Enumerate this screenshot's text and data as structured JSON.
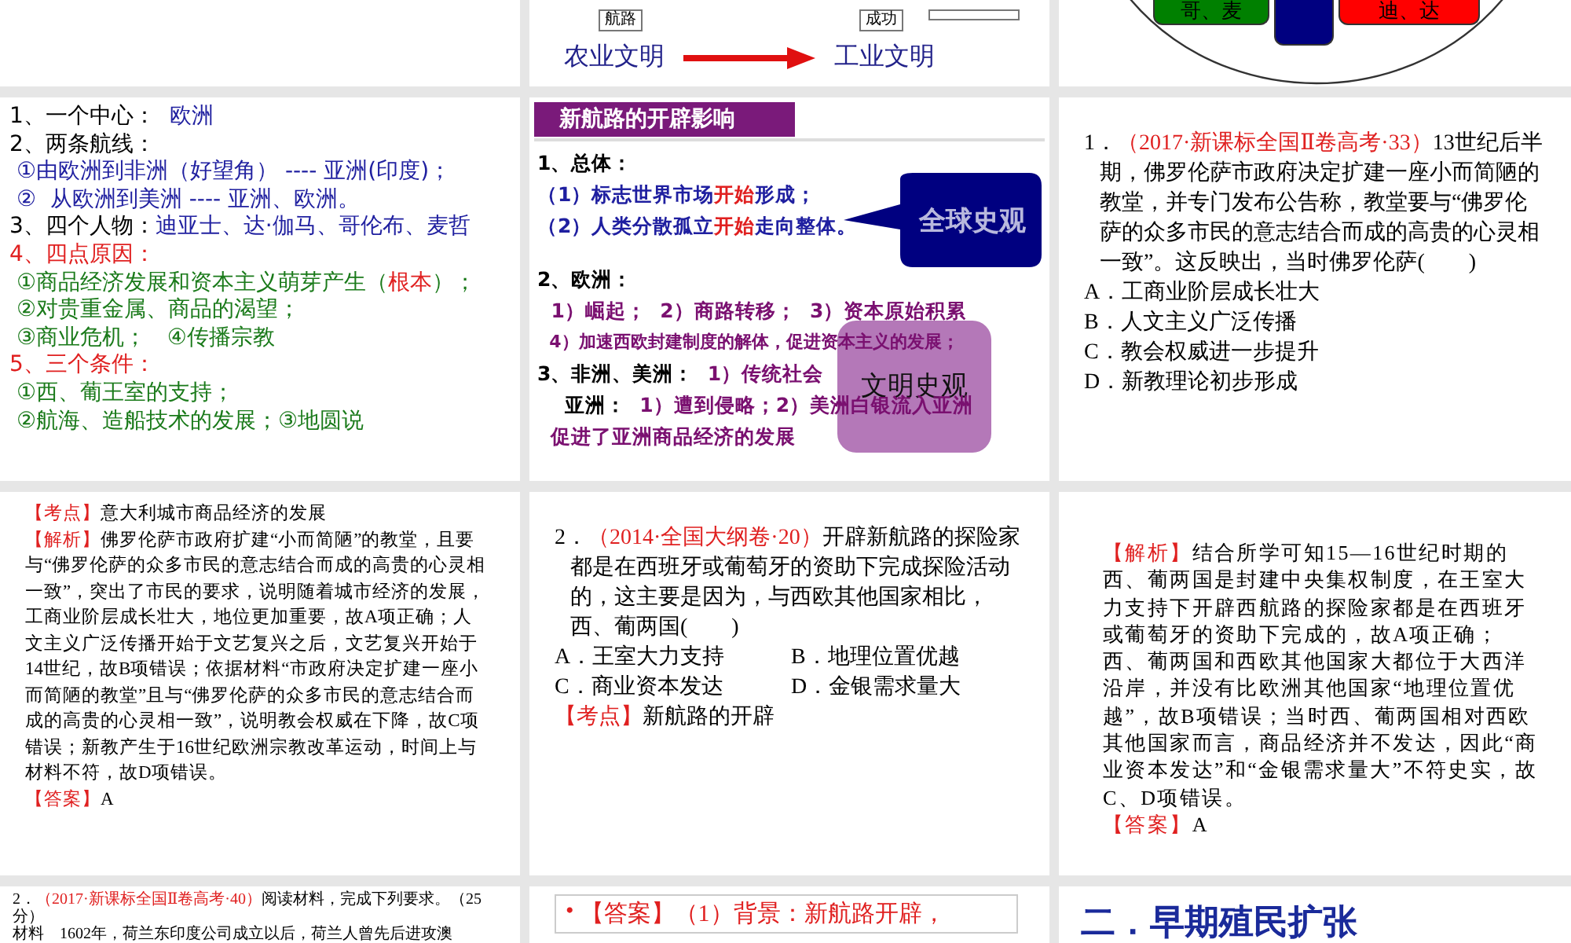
{
  "slides": [
    {
      "kind": "blank"
    },
    {
      "kind": "flow",
      "boxes": [
        "航路",
        "成功"
      ],
      "from": "农业文明",
      "to": "工业文明"
    },
    {
      "kind": "circle",
      "boxes": [
        {
          "text": "哥、麦",
          "color": "#008000"
        },
        {
          "color": "#000080"
        },
        {
          "text": "迪、达",
          "color": "#ff0000"
        }
      ]
    },
    {
      "kind": "outline",
      "lines": [
        {
          "segments": [
            {
              "text": "1、一个中心：  ",
              "color": "#000000"
            },
            {
              "text": "欧洲",
              "color": "#2020a0"
            }
          ]
        },
        {
          "segments": [
            {
              "text": "2、两条航线：",
              "color": "#000000"
            }
          ]
        },
        {
          "segments": [
            {
              "text": " ①由欧洲到非洲（好望角） ---- 亚洲(印度)；",
              "color": "#2020a0"
            }
          ]
        },
        {
          "segments": [
            {
              "text": " ②  从欧洲到美洲 ---- 亚洲、欧洲。",
              "color": "#2020a0"
            }
          ]
        },
        {
          "segments": [
            {
              "text": "3、四个人物：",
              "color": "#000000"
            },
            {
              "text": "迪亚士、达·伽马、哥伦布、麦哲",
              "color": "#2020a0"
            }
          ]
        },
        {
          "segments": [
            {
              "text": "4、四点原因：",
              "color": "#e02020"
            }
          ]
        },
        {
          "segments": [
            {
              "text": " ①商品经济发展和资本主义萌芽产生（",
              "color": "#1a7a1a"
            },
            {
              "text": "根本",
              "color": "#e02020"
            },
            {
              "text": "）；",
              "color": "#1a7a1a"
            }
          ]
        },
        {
          "segments": [
            {
              "text": " ②对贵重金属、商品的渴望；",
              "color": "#1a7a1a"
            }
          ]
        },
        {
          "segments": [
            {
              "text": " ③商业危机；   ④传播宗教",
              "color": "#1a7a1a"
            }
          ]
        },
        {
          "segments": [
            {
              "text": "5、三个条件：",
              "color": "#e02020"
            }
          ]
        },
        {
          "segments": [
            {
              "text": " ①西、葡王室的支持；",
              "color": "#1a7a1a"
            }
          ]
        },
        {
          "segments": [
            {
              "text": " ②航海、造船技术的发展；③地圆说",
              "color": "#1a7a1a"
            }
          ]
        }
      ]
    },
    {
      "kind": "impact",
      "title": "新航路的开辟影响",
      "lines": [
        {
          "segments": [
            {
              "text": "1、总体：",
              "color": "#000000"
            }
          ]
        },
        {
          "segments": [
            {
              "text": "（1）标志世界市场",
              "color": "#1f1fa0"
            },
            {
              "text": "开始",
              "color": "#e02020"
            },
            {
              "text": "形成；",
              "color": "#1f1fa0"
            }
          ]
        },
        {
          "segments": [
            {
              "text": "（2）人类分散孤立",
              "color": "#1f1fa0"
            },
            {
              "text": "开始",
              "color": "#e02020"
            },
            {
              "text": "走向整体。",
              "color": "#1f1fa0"
            }
          ]
        },
        {
          "segments": [
            {
              "text": "2、欧洲：",
              "color": "#000000"
            }
          ]
        },
        {
          "segments": [
            {
              "text": "  1）崛起；  2）商路转移；  3）资本原始积累",
              "color": "#7a1070"
            }
          ]
        },
        {
          "segments": [
            {
              "text": "  4）加速西欧封建制度的解体，促进资本主义的发展；",
              "color": "#7a1070"
            }
          ]
        },
        {
          "segments": [
            {
              "text": "3、非洲、美洲：  ",
              "color": "#000000"
            },
            {
              "text": "1）传统社会",
              "color": "#7a1070"
            }
          ]
        },
        {
          "segments": [
            {
              "text": "    亚洲：  ",
              "color": "#000000"
            },
            {
              "text": "1）遭到侵略；2）美洲白银流入亚洲",
              "color": "#7a1070"
            }
          ]
        },
        {
          "segments": [
            {
              "text": "  促进了亚洲商品经济的发展",
              "color": "#7a1070"
            }
          ]
        }
      ],
      "bubbles": [
        {
          "text": "全球史观",
          "color": "#000080"
        },
        {
          "text": "文明史观",
          "color": "#b478b8"
        }
      ]
    },
    {
      "kind": "question",
      "paragraphs": [
        {
          "segments": [
            {
              "text": "1．",
              "color": "#000000"
            },
            {
              "text": "（2017·新课标全国Ⅱ卷高考·33）",
              "color": "#e02020"
            },
            {
              "text": "13世纪后半期，佛罗伦萨市政府决定扩建一座小而简陋的教堂，并专门发布公告称，教堂要与“佛罗伦萨的众多市民的意志结合而成的高贵的心灵相一致”。这反映出，当时佛罗伦萨(　　)",
              "color": "#000000"
            }
          ]
        }
      ],
      "options": [
        [
          "A．工商业阶层成长壮大"
        ],
        [
          "B．人文主义广泛传播"
        ],
        [
          "C．教会权威进一步提升"
        ],
        [
          "D．新教理论初步形成"
        ]
      ]
    },
    {
      "kind": "analysis",
      "paragraphs": [
        {
          "segments": [
            {
              "text": "【考点】",
              "color": "#e02020"
            },
            {
              "text": "意大利城市商品经济的发展",
              "color": "#000000"
            }
          ]
        },
        {
          "segments": [
            {
              "text": "【解析】",
              "color": "#e02020"
            },
            {
              "text": "佛罗伦萨市政府扩建“小而简陋”的教堂，且要与“佛罗伦萨的众多市民的意志结合而成的高贵的心灵相一致”，突出了市民的要求，说明随着城市经济的发展，工商业阶层成长壮大，地位更加重要，故A项正确；人文主义广泛传播开始于文艺复兴之后，文艺复兴开始于14世纪，故B项错误；依据材料“市政府决定扩建一座小而简陋的教堂”且与“佛罗伦萨的众多市民的意志结合而成的高贵的心灵相一致”，说明教会权威在下降，故C项错误；新教产生于16世纪欧洲宗教改革运动，时间上与材料不符，故D项错误。",
              "color": "#000000"
            }
          ]
        },
        {
          "segments": [
            {
              "text": "【答案】",
              "color": "#e02020"
            },
            {
              "text": "A",
              "color": "#000000"
            }
          ]
        }
      ]
    },
    {
      "kind": "question",
      "paragraphs": [
        {
          "segments": [
            {
              "text": "2．",
              "color": "#000000"
            },
            {
              "text": "（2014·全国大纲卷·20）",
              "color": "#e02020"
            },
            {
              "text": "开辟新航路的探险家都是在西班牙或葡萄牙的资助下完成探险活动的，这主要是因为，与西欧其他国家相比，西、葡两国(　　)",
              "color": "#000000"
            }
          ]
        }
      ],
      "options": [
        [
          "A．王室大力支持",
          "B．地理位置优越"
        ],
        [
          "C．商业资本发达",
          "D．金银需求量大"
        ]
      ],
      "note": [
        {
          "text": "【考点】",
          "color": "#e02020"
        },
        {
          "text": "新航路的开辟",
          "color": "#000000"
        }
      ]
    },
    {
      "kind": "analysis",
      "paragraphs": [
        {
          "segments": [
            {
              "text": "【解析】",
              "color": "#e02020"
            },
            {
              "text": "结合所学可知15—16世纪时期的西、葡两国是封建中央集权制度，在王室大力支持下开辟西航路的探险家都是在西班牙或葡萄牙的资助下完成的，故A项正确；西、葡两国和西欧其他国家大都位于大西洋沿岸，并没有比欧洲其他国家“地理位置优越”，故B项错误；当时西、葡两国相对西欧其他国家而言，商品经济并不发达，因此“商业资本发达”和“金银需求量大”不符史实，故C、D项错误。",
              "color": "#000000"
            }
          ]
        },
        {
          "segments": [
            {
              "text": "【答案】",
              "color": "#e02020"
            },
            {
              "text": "A",
              "color": "#000000"
            }
          ]
        }
      ]
    },
    {
      "kind": "material",
      "paragraphs": [
        {
          "segments": [
            {
              "text": "2．",
              "color": "#000000"
            },
            {
              "text": "（2017·新课标全国Ⅱ卷高考·40）",
              "color": "#e02020"
            },
            {
              "text": "阅读材料，完成下列要求。（25分）",
              "color": "#000000"
            }
          ]
        },
        {
          "segments": [
            {
              "text": "材料　1602年，荷兰东印度公司成立以后，荷兰人曾先后进攻澳",
              "color": "#000000"
            }
          ]
        }
      ]
    },
    {
      "kind": "answer",
      "bullet": "•",
      "segments": [
        {
          "text": "【答案】（1）背景：新航路开辟，",
          "color": "#e02020"
        }
      ]
    },
    {
      "kind": "heading",
      "title": "二．早期殖民扩张"
    }
  ]
}
